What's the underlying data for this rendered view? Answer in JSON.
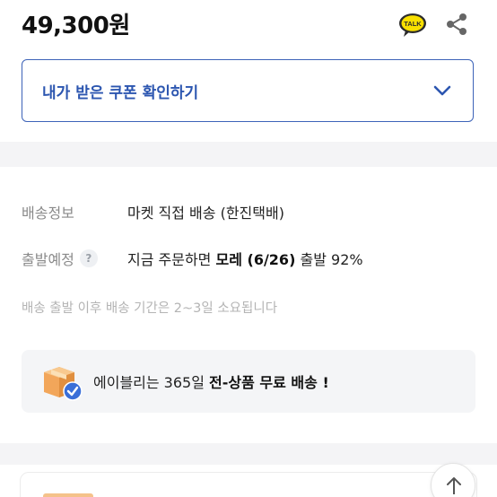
{
  "product": {
    "price": "49,300원",
    "talk_icon_text": "TALK"
  },
  "coupon": {
    "label": "내가 받은 쿠폰 확인하기"
  },
  "shipping": {
    "info_label": "배송정보",
    "info_value": "마켓 직접 배송 (한진택배)",
    "schedule_label": "출발예정",
    "help_symbol": "?",
    "schedule_prefix": "지금 주문하면",
    "schedule_date": "모레 (6/26)",
    "schedule_suffix": "출발 92%",
    "note": "배송 출발 이후 배송 기간은 2~3일 소요됩니다"
  },
  "banner": {
    "text_prefix": "에이블리는 365일",
    "text_bold": "전-상품 무료 배송 !"
  },
  "colors": {
    "accent_blue": "#3d63b8",
    "muted_gray": "#8a8a8a",
    "kakao_yellow": "#f9e000",
    "box_orange": "#f2a65a",
    "check_blue": "#3a6fd8"
  },
  "icons": {
    "talk": "kakao-talk-icon",
    "share": "share-icon",
    "chevron": "chevron-down-icon",
    "box": "delivery-box-icon",
    "check": "check-badge-icon",
    "scroll_top": "arrow-up-icon"
  }
}
